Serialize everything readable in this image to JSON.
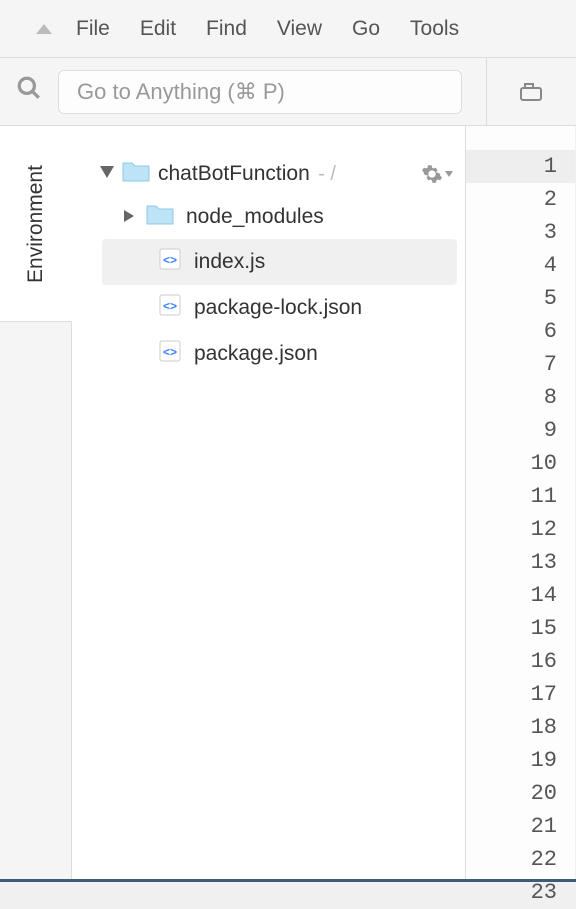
{
  "menubar": {
    "items": [
      "File",
      "Edit",
      "Find",
      "View",
      "Go",
      "Tools"
    ]
  },
  "search": {
    "placeholder": "Go to Anything (⌘ P)"
  },
  "side_tab": {
    "label": "Environment"
  },
  "project": {
    "name": "chatBotFunction",
    "suffix": "- /",
    "children": [
      {
        "type": "folder",
        "name": "node_modules",
        "expanded": false
      },
      {
        "type": "file",
        "name": "index.js",
        "selected": true
      },
      {
        "type": "file",
        "name": "package-lock.json",
        "selected": false
      },
      {
        "type": "file",
        "name": "package.json",
        "selected": false
      }
    ]
  },
  "editor": {
    "active_line": 1,
    "line_count": 23
  }
}
